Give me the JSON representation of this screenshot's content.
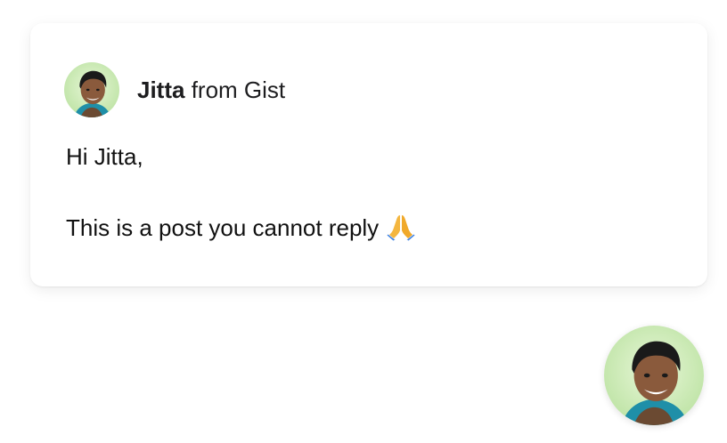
{
  "message_card": {
    "sender_name": "Jitta",
    "sender_suffix": " from Gist",
    "greeting": "Hi Jitta,",
    "body_text": "This is a post you cannot reply",
    "body_emoji": "folded-hands-icon"
  },
  "launcher": {
    "avatar": "avatar"
  },
  "colors": {
    "avatar_bg": "#cdeeb8",
    "skin": "#8a5a3c",
    "hair": "#1a1a1a",
    "shirt": "#2a9bb8"
  }
}
